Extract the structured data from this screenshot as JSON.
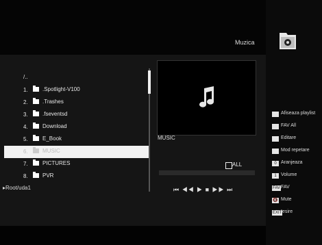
{
  "screen": {
    "title": "Muzica",
    "icons": {
      "header": "folder-music-icon",
      "preview": "music-note-icon"
    }
  },
  "file_list": {
    "parent": "/..",
    "items": [
      {
        "num": "1.",
        "name": ".Spotlight-V100"
      },
      {
        "num": "2.",
        "name": ".Trashes"
      },
      {
        "num": "3.",
        "name": ".fseventsd"
      },
      {
        "num": "4.",
        "name": "Download"
      },
      {
        "num": "5.",
        "name": "E_Book"
      },
      {
        "num": "6.",
        "name": "MUSIC",
        "selected": true
      },
      {
        "num": "7.",
        "name": "PICTURES"
      },
      {
        "num": "8.",
        "name": "PVR"
      }
    ],
    "path": "Root/uda1"
  },
  "preview": {
    "label": "MUSIC"
  },
  "playback": {
    "all_label": "ALL",
    "controls": [
      "rewind",
      "previous",
      "play",
      "stop",
      "next",
      "fast-forward"
    ],
    "control_glyphs": "⏮ ◀◀ ▶ ■ ▶▶ ⏭"
  },
  "menu": [
    {
      "key": "",
      "label": "Afiseaza playlist"
    },
    {
      "key": "",
      "label": "FAV All"
    },
    {
      "key": "",
      "label": "Editare"
    },
    {
      "key": "",
      "label": "Mod repetare"
    },
    {
      "key": "0",
      "label": "Aranjeaza"
    },
    {
      "key": "1",
      "label": "Volume"
    },
    {
      "key": "FAV",
      "label": "FAV"
    },
    {
      "key": "🔇",
      "label": "Mute"
    },
    {
      "key": "EXIT",
      "label": "Iesire"
    }
  ]
}
